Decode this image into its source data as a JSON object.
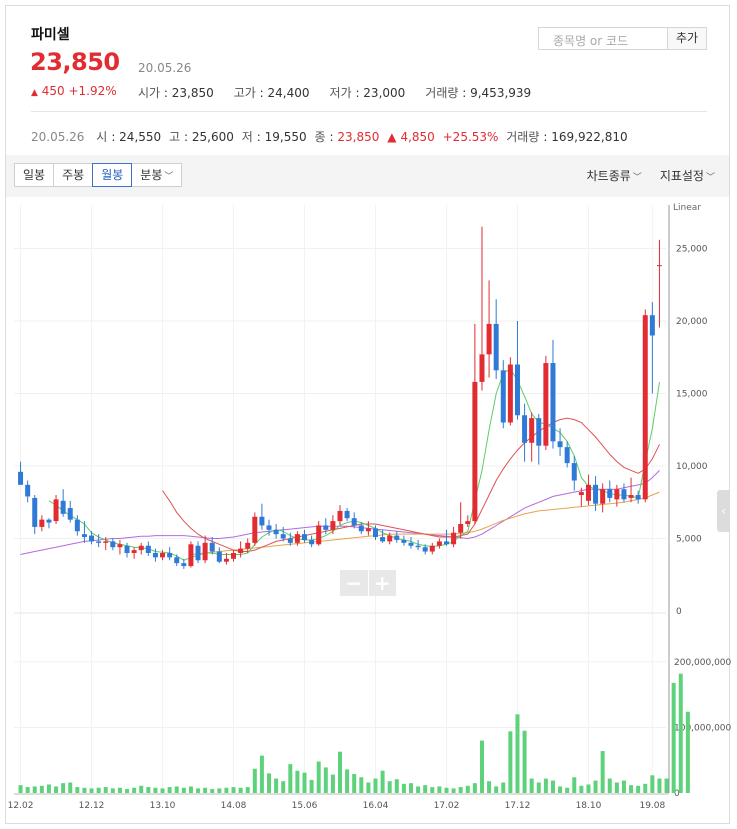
{
  "header": {
    "name": "파미셀",
    "price": "23,850",
    "date": "20.05.26",
    "change_arrow": "▲",
    "change": "450 +1.92%",
    "stats": [
      {
        "label": "시가",
        "value": "23,850"
      },
      {
        "label": "고가",
        "value": "24,400"
      },
      {
        "label": "저가",
        "value": "23,000"
      },
      {
        "label": "거래량",
        "value": "9,453,939"
      }
    ],
    "search_placeholder": "종목명 or 코드",
    "add_label": "추가"
  },
  "sub_info": {
    "date": "20.05.26",
    "open_label": "시",
    "open": "24,550",
    "high_label": "고",
    "high": "25,600",
    "low_label": "저",
    "low": "19,550",
    "close_label": "종",
    "close": "23,850",
    "change_arrow": "▲",
    "change": "4,850",
    "change_pct": "+25.53%",
    "volume_label": "거래량",
    "volume": "169,922,810"
  },
  "toolbar": {
    "tabs": [
      {
        "label": "일봉",
        "active": false
      },
      {
        "label": "주봉",
        "active": false
      },
      {
        "label": "월봉",
        "active": true
      },
      {
        "label": "분봉",
        "active": false,
        "dropdown": true
      }
    ],
    "chart_type": "차트종류",
    "indicator": "지표설정"
  },
  "colors": {
    "up": "#e22c32",
    "down": "#2f7ad6",
    "volume": "#5dd27a",
    "ma5": "#5ccd66",
    "ma20": "#e05252",
    "ma60": "#b26be0",
    "ma120": "#e8a24c"
  },
  "chart_data": {
    "type": "candlestick",
    "scale_label": "Linear",
    "x_ticks": [
      "12.02",
      "12.12",
      "13.10",
      "14.08",
      "15.06",
      "16.04",
      "17.02",
      "17.12",
      "18.10",
      "19.08"
    ],
    "price_ticks": [
      "0",
      "5,000",
      "10,000",
      "15,000",
      "20,000",
      "25,000"
    ],
    "volume_ticks": [
      "0",
      "100,000,000",
      "200,000,000"
    ],
    "ylim": [
      0,
      28000
    ],
    "volume_ylim": [
      0,
      270000000
    ],
    "candles": [
      {
        "o": 9600,
        "h": 10300,
        "l": 8900,
        "c": 8700
      },
      {
        "o": 8700,
        "h": 9000,
        "l": 7500,
        "c": 7900
      },
      {
        "o": 7800,
        "h": 8000,
        "l": 5300,
        "c": 5800
      },
      {
        "o": 5800,
        "h": 6600,
        "l": 5500,
        "c": 6300
      },
      {
        "o": 6300,
        "h": 6400,
        "l": 5700,
        "c": 6100
      },
      {
        "o": 6200,
        "h": 8000,
        "l": 6000,
        "c": 7700
      },
      {
        "o": 7600,
        "h": 8400,
        "l": 6500,
        "c": 6700
      },
      {
        "o": 7100,
        "h": 7600,
        "l": 6100,
        "c": 6300
      },
      {
        "o": 6300,
        "h": 6600,
        "l": 5200,
        "c": 5500
      },
      {
        "o": 5300,
        "h": 6200,
        "l": 4700,
        "c": 5100
      },
      {
        "o": 5200,
        "h": 5500,
        "l": 4600,
        "c": 4800
      },
      {
        "o": 4800,
        "h": 5300,
        "l": 4400,
        "c": 4700
      },
      {
        "o": 4700,
        "h": 5100,
        "l": 4200,
        "c": 4800
      },
      {
        "o": 4800,
        "h": 5000,
        "l": 4200,
        "c": 4400
      },
      {
        "o": 4400,
        "h": 4900,
        "l": 3900,
        "c": 4600
      },
      {
        "o": 4500,
        "h": 4700,
        "l": 3700,
        "c": 4000
      },
      {
        "o": 4000,
        "h": 4400,
        "l": 3600,
        "c": 4200
      },
      {
        "o": 4200,
        "h": 4700,
        "l": 3900,
        "c": 4500
      },
      {
        "o": 4500,
        "h": 4800,
        "l": 3800,
        "c": 4000
      },
      {
        "o": 4000,
        "h": 4300,
        "l": 3400,
        "c": 3700
      },
      {
        "o": 3700,
        "h": 4200,
        "l": 3500,
        "c": 4000
      },
      {
        "o": 4000,
        "h": 4400,
        "l": 3500,
        "c": 3700
      },
      {
        "o": 3700,
        "h": 3900,
        "l": 3100,
        "c": 3300
      },
      {
        "o": 3300,
        "h": 3600,
        "l": 2900,
        "c": 3100
      },
      {
        "o": 3100,
        "h": 4800,
        "l": 3000,
        "c": 4600
      },
      {
        "o": 4500,
        "h": 4800,
        "l": 3300,
        "c": 3500
      },
      {
        "o": 3500,
        "h": 5200,
        "l": 3300,
        "c": 4700
      },
      {
        "o": 4700,
        "h": 5100,
        "l": 3900,
        "c": 4100
      },
      {
        "o": 4100,
        "h": 4400,
        "l": 3300,
        "c": 3400
      },
      {
        "o": 3400,
        "h": 4000,
        "l": 3200,
        "c": 3600
      },
      {
        "o": 3600,
        "h": 4200,
        "l": 3400,
        "c": 4000
      },
      {
        "o": 4000,
        "h": 4800,
        "l": 3700,
        "c": 4300
      },
      {
        "o": 4300,
        "h": 5000,
        "l": 4000,
        "c": 4700
      },
      {
        "o": 4700,
        "h": 6800,
        "l": 4500,
        "c": 6500
      },
      {
        "o": 6500,
        "h": 7400,
        "l": 5600,
        "c": 5900
      },
      {
        "o": 5900,
        "h": 6300,
        "l": 5200,
        "c": 5600
      },
      {
        "o": 5600,
        "h": 6000,
        "l": 5000,
        "c": 5300
      },
      {
        "o": 5300,
        "h": 5800,
        "l": 4800,
        "c": 5000
      },
      {
        "o": 5000,
        "h": 5400,
        "l": 4500,
        "c": 4700
      },
      {
        "o": 4700,
        "h": 5500,
        "l": 4500,
        "c": 5300
      },
      {
        "o": 5300,
        "h": 5600,
        "l": 4700,
        "c": 4900
      },
      {
        "o": 4900,
        "h": 5200,
        "l": 4400,
        "c": 4600
      },
      {
        "o": 4600,
        "h": 6200,
        "l": 4500,
        "c": 5900
      },
      {
        "o": 5900,
        "h": 6400,
        "l": 5300,
        "c": 5600
      },
      {
        "o": 5600,
        "h": 6600,
        "l": 5300,
        "c": 6200
      },
      {
        "o": 6200,
        "h": 7300,
        "l": 5900,
        "c": 6900
      },
      {
        "o": 6900,
        "h": 7100,
        "l": 6200,
        "c": 6400
      },
      {
        "o": 6400,
        "h": 6800,
        "l": 5700,
        "c": 5900
      },
      {
        "o": 5900,
        "h": 6100,
        "l": 5300,
        "c": 5500
      },
      {
        "o": 5500,
        "h": 6200,
        "l": 5200,
        "c": 5700
      },
      {
        "o": 5700,
        "h": 5900,
        "l": 4900,
        "c": 5100
      },
      {
        "o": 5100,
        "h": 5600,
        "l": 4700,
        "c": 4800
      },
      {
        "o": 4800,
        "h": 5400,
        "l": 4600,
        "c": 5200
      },
      {
        "o": 5200,
        "h": 5500,
        "l": 4700,
        "c": 4900
      },
      {
        "o": 4900,
        "h": 5200,
        "l": 4500,
        "c": 4700
      },
      {
        "o": 4700,
        "h": 5100,
        "l": 4300,
        "c": 4500
      },
      {
        "o": 4500,
        "h": 4900,
        "l": 4200,
        "c": 4400
      },
      {
        "o": 4400,
        "h": 4600,
        "l": 3900,
        "c": 4100
      },
      {
        "o": 4100,
        "h": 4700,
        "l": 3900,
        "c": 4500
      },
      {
        "o": 4500,
        "h": 5000,
        "l": 4300,
        "c": 4800
      },
      {
        "o": 4800,
        "h": 5600,
        "l": 4500,
        "c": 4600
      },
      {
        "o": 4600,
        "h": 5800,
        "l": 4400,
        "c": 5400
      },
      {
        "o": 5400,
        "h": 7500,
        "l": 5000,
        "c": 6000
      },
      {
        "o": 6000,
        "h": 6600,
        "l": 5800,
        "c": 6200
      },
      {
        "o": 6200,
        "h": 19800,
        "l": 6000,
        "c": 15800
      },
      {
        "o": 15800,
        "h": 26500,
        "l": 15200,
        "c": 17700
      },
      {
        "o": 17700,
        "h": 22800,
        "l": 16100,
        "c": 19800
      },
      {
        "o": 19800,
        "h": 21500,
        "l": 16000,
        "c": 16600
      },
      {
        "o": 16600,
        "h": 17300,
        "l": 12600,
        "c": 13000
      },
      {
        "o": 13000,
        "h": 17500,
        "l": 12800,
        "c": 17000
      },
      {
        "o": 17000,
        "h": 20000,
        "l": 13200,
        "c": 13500
      },
      {
        "o": 13500,
        "h": 14300,
        "l": 10300,
        "c": 11600
      },
      {
        "o": 11600,
        "h": 13700,
        "l": 10300,
        "c": 13300
      },
      {
        "o": 13300,
        "h": 13600,
        "l": 10100,
        "c": 11400
      },
      {
        "o": 11400,
        "h": 17600,
        "l": 11100,
        "c": 17100
      },
      {
        "o": 17100,
        "h": 18700,
        "l": 11200,
        "c": 11700
      },
      {
        "o": 11700,
        "h": 12600,
        "l": 10700,
        "c": 11300
      },
      {
        "o": 11300,
        "h": 11700,
        "l": 9900,
        "c": 10200
      },
      {
        "o": 10200,
        "h": 10700,
        "l": 8300,
        "c": 9000
      },
      {
        "o": 8000,
        "h": 8500,
        "l": 7200,
        "c": 8200
      },
      {
        "o": 7600,
        "h": 9400,
        "l": 7300,
        "c": 8700
      },
      {
        "o": 8700,
        "h": 9300,
        "l": 6900,
        "c": 7400
      },
      {
        "o": 7400,
        "h": 8800,
        "l": 6800,
        "c": 8400
      },
      {
        "o": 8400,
        "h": 9000,
        "l": 7500,
        "c": 7800
      },
      {
        "o": 7700,
        "h": 8700,
        "l": 7200,
        "c": 8400
      },
      {
        "o": 8400,
        "h": 8800,
        "l": 7500,
        "c": 7700
      },
      {
        "o": 7800,
        "h": 9200,
        "l": 7500,
        "c": 8000
      },
      {
        "o": 8000,
        "h": 8300,
        "l": 7400,
        "c": 7700
      },
      {
        "o": 7700,
        "h": 20800,
        "l": 7500,
        "c": 20400
      },
      {
        "o": 20400,
        "h": 21300,
        "l": 15000,
        "c": 19000
      },
      {
        "o": 23800,
        "h": 25600,
        "l": 19550,
        "c": 23850
      }
    ],
    "volumes": [
      12,
      9,
      10,
      11,
      13,
      10,
      15,
      16,
      9,
      8,
      7,
      8,
      9,
      7,
      8,
      6,
      8,
      11,
      9,
      8,
      7,
      9,
      10,
      8,
      10,
      7,
      8,
      6,
      7,
      8,
      9,
      8,
      9,
      37,
      57,
      30,
      22,
      18,
      44,
      34,
      31,
      20,
      48,
      39,
      28,
      63,
      36,
      29,
      24,
      16,
      22,
      34,
      18,
      21,
      14,
      15,
      10,
      12,
      9,
      10,
      8,
      7,
      9,
      11,
      15,
      80,
      18,
      10,
      16,
      94,
      120,
      95,
      22,
      16,
      22,
      19,
      10,
      8,
      24,
      11,
      13,
      19,
      64,
      22,
      16,
      19,
      12,
      11,
      14,
      27,
      22,
      22,
      168,
      182,
      124
    ],
    "volume_scale_max": 270000000,
    "volume_unit": 1000000,
    "ma5": [
      null,
      null,
      null,
      null,
      7600,
      7300,
      6900,
      6600,
      6300,
      6000,
      5400,
      5100,
      4900,
      4700,
      4600,
      4500,
      4400,
      4350,
      4300,
      4100,
      4050,
      4000,
      3800,
      3500,
      3700,
      3850,
      4000,
      4000,
      3900,
      3900,
      3900,
      3900,
      4000,
      4600,
      5100,
      5400,
      5600,
      5500,
      5200,
      5000,
      4900,
      4900,
      5000,
      5200,
      5500,
      5900,
      6100,
      6200,
      6100,
      5900,
      5700,
      5400,
      5200,
      5000,
      4900,
      4800,
      4600,
      4500,
      4450,
      4500,
      4600,
      4800,
      5200,
      5500,
      7600,
      9700,
      12500,
      15000,
      16400,
      16700,
      15900,
      14800,
      13600,
      13000,
      12900,
      12600,
      12300,
      11700,
      10700,
      9200,
      8600,
      8400,
      8300,
      8100,
      8000,
      8000,
      7900,
      7800,
      10300,
      12600,
      15800
    ],
    "ma20": [
      null,
      null,
      null,
      null,
      null,
      null,
      null,
      null,
      null,
      null,
      null,
      null,
      null,
      null,
      null,
      null,
      null,
      null,
      null,
      null,
      8300,
      7600,
      6800,
      6200,
      5700,
      5300,
      5000,
      4800,
      4600,
      4400,
      4200,
      4100,
      4100,
      4200,
      4400,
      4600,
      4800,
      4900,
      5000,
      5100,
      5200,
      5300,
      5400,
      5500,
      5600,
      5700,
      5800,
      5900,
      6000,
      6000,
      6000,
      5900,
      5800,
      5700,
      5600,
      5500,
      5400,
      5300,
      5200,
      5100,
      5100,
      5100,
      5200,
      5300,
      6000,
      7000,
      8000,
      9000,
      9800,
      10500,
      11100,
      11600,
      12000,
      12400,
      12700,
      13000,
      13200,
      13300,
      13200,
      13000,
      12500,
      12000,
      11400,
      10800,
      10300,
      9900,
      9700,
      9500,
      9800,
      10500,
      11500
    ],
    "ma60": [
      3900,
      4000,
      4100,
      4200,
      4300,
      4400,
      4500,
      4600,
      4700,
      4800,
      4850,
      4900,
      4950,
      5000,
      5000,
      5050,
      5100,
      5150,
      5150,
      5200,
      5200,
      5200,
      5200,
      5200,
      5150,
      5100,
      5050,
      5000,
      5000,
      5050,
      5100,
      5200,
      5300,
      5400,
      5450,
      5500,
      5550,
      5600,
      5650,
      5700,
      5750,
      5800,
      5850,
      5850,
      5850,
      5850,
      5850,
      5800,
      5750,
      5700,
      5650,
      5600,
      5550,
      5500,
      5450,
      5400,
      5350,
      5300,
      5250,
      5200,
      5150,
      5100,
      5050,
      5000,
      5100,
      5300,
      5600,
      5900,
      6200,
      6500,
      6800,
      7100,
      7300,
      7500,
      7700,
      7900,
      8000,
      8100,
      8200,
      8300,
      8400,
      8400,
      8400,
      8400,
      8400,
      8500,
      8600,
      8700,
      8800,
      9200,
      9700
    ],
    "ma120": [
      null,
      null,
      null,
      null,
      null,
      null,
      null,
      null,
      null,
      null,
      null,
      null,
      null,
      null,
      null,
      null,
      null,
      null,
      null,
      null,
      null,
      null,
      null,
      null,
      3900,
      3950,
      4000,
      4050,
      4100,
      4150,
      4200,
      4250,
      4300,
      4350,
      4400,
      4450,
      4500,
      4550,
      4600,
      4650,
      4700,
      4750,
      4800,
      4850,
      4900,
      4950,
      5000,
      5050,
      5100,
      5150,
      5200,
      5250,
      5300,
      5300,
      5300,
      5300,
      5300,
      5300,
      5300,
      5300,
      5300,
      5300,
      5350,
      5400,
      5500,
      5650,
      5850,
      6050,
      6250,
      6400,
      6550,
      6700,
      6800,
      6900,
      6950,
      7000,
      7050,
      7100,
      7150,
      7200,
      7250,
      7300,
      7350,
      7400,
      7450,
      7500,
      7600,
      7700,
      7800,
      8000,
      8200
    ]
  }
}
